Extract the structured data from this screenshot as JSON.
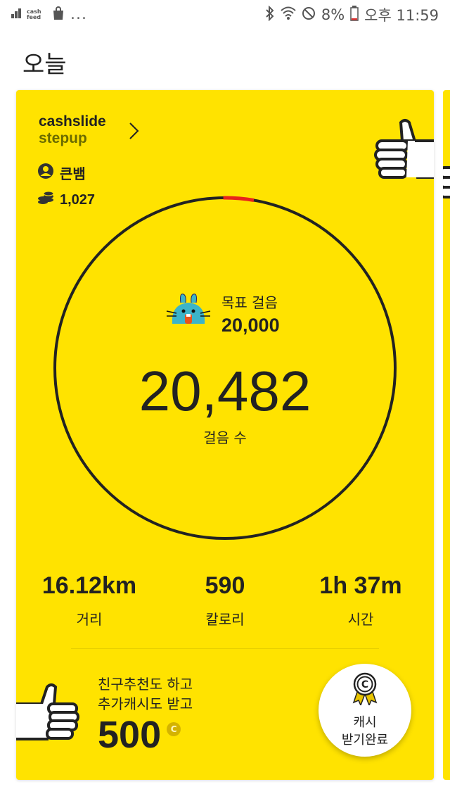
{
  "status_bar": {
    "left_app_name": "cash feed",
    "overflow": "...",
    "battery": "8%",
    "time": "오후 11:59"
  },
  "page": {
    "title": "오늘"
  },
  "card": {
    "brand_line1": "cashslide",
    "brand_line2": "stepup",
    "user_name": "큰뱀",
    "coins": "1,027",
    "goal_label": "목표 걸음",
    "goal_value": "20,000",
    "steps_value": "20,482",
    "steps_label": "걸음 수",
    "progress_fraction": 1.0,
    "stats": [
      {
        "value": "16.12km",
        "label": "거리"
      },
      {
        "value": "590",
        "label": "칼로리"
      },
      {
        "value": "1h 37m",
        "label": "시간"
      }
    ],
    "promo_line1": "친구추천도 하고",
    "promo_line2": "추가캐시도 받고",
    "promo_amount": "500",
    "promo_coin_symbol": "C",
    "cash_button_line1": "캐시",
    "cash_button_line2": "받기완료"
  },
  "colors": {
    "card_bg": "#FFE300",
    "ring": "#222222",
    "ring_marker": "#E8231B"
  }
}
